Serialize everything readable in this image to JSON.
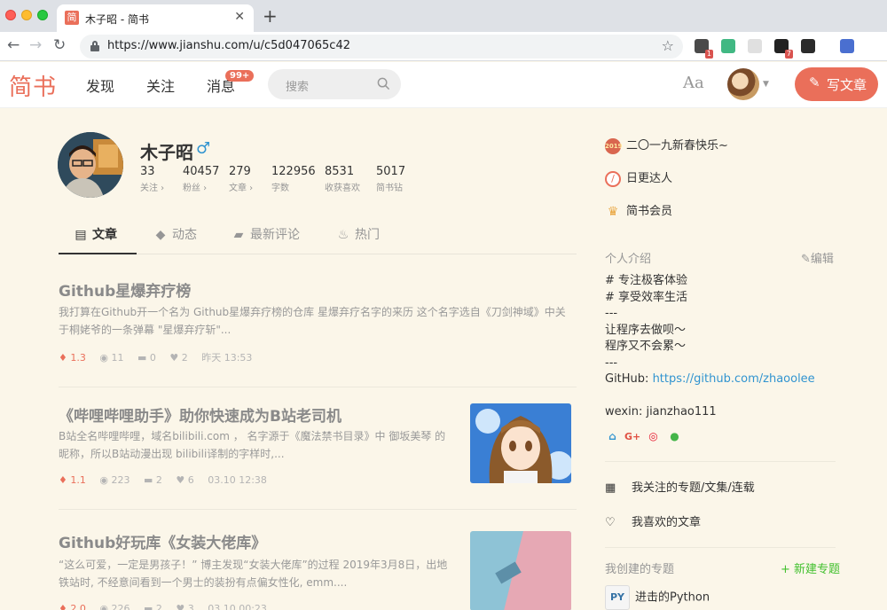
{
  "browser": {
    "tab_title": "木子昭 - 简书",
    "tab_favicon_char": "简",
    "url": "https://www.jianshu.com/u/c5d047065c42",
    "extensions": [
      {
        "name": "ext-grid-icon",
        "color": "#4a4a4a",
        "badge": "1"
      },
      {
        "name": "vue-devtools-icon",
        "color": "#41b883",
        "badge": ""
      },
      {
        "name": "blank-ext-icon",
        "color": "#e0e0e0",
        "badge": ""
      },
      {
        "name": "dark-ext-icon",
        "color": "#222222",
        "badge": "7"
      },
      {
        "name": "x-ext-icon",
        "color": "#2b2b2b",
        "badge": ""
      },
      {
        "name": "music-ext-icon",
        "color": "#4a6fd0",
        "badge": ""
      }
    ]
  },
  "site": {
    "logo": "简书",
    "nav": [
      "发现",
      "关注",
      "消息"
    ],
    "message_badge": "99+",
    "search_placeholder": "搜索",
    "font_toggle": "Aa",
    "write_label": "写文章",
    "accent": "#ea6f5a"
  },
  "profile": {
    "name": "木子昭",
    "gender_icon": "♂",
    "stats": [
      {
        "value": "33",
        "label": "关注 ›"
      },
      {
        "value": "40457",
        "label": "粉丝 ›"
      },
      {
        "value": "279",
        "label": "文章 ›"
      },
      {
        "value": "122956",
        "label": "字数"
      },
      {
        "value": "8531",
        "label": "收获喜欢"
      },
      {
        "value": "5017",
        "label": "简书钻"
      }
    ],
    "tabs": [
      "文章",
      "动态",
      "最新评论",
      "热门"
    ]
  },
  "articles": [
    {
      "title": "Github星爆弃疗榜",
      "abstract": "我打算在Github开一个名为 Github星爆弃疗榜的仓库 星爆弃疗名字的来历 这个名字选自《刀剑神域》中关于桐姥爷的一条弹幕 \"星爆弃疗斩\"...",
      "diamond": "1.3",
      "views": "11",
      "comments": "0",
      "likes": "2",
      "time": "昨天 13:53"
    },
    {
      "title": "《哔哩哔哩助手》助你快速成为B站老司机",
      "abstract": "B站全名哔哩哔哩，域名bilibili.com ， 名字源于《魔法禁书目录》中 御坂美琴 的昵称，所以B站动漫出现 bilibili译制的字样时,...",
      "diamond": "1.1",
      "views": "223",
      "comments": "2",
      "likes": "6",
      "time": "03.10 12:38"
    },
    {
      "title": "Github好玩库《女装大佬库》",
      "abstract": "“这么可爱，一定是男孩子！” 博主发现“女装大佬库”的过程 2019年3月8日，出地铁站时, 不经意间看到一个男士的装扮有点偏女性化, emm....",
      "diamond": "2.0",
      "views": "226",
      "comments": "2",
      "likes": "3",
      "time": "03.10 00:23"
    }
  ],
  "sidebar": {
    "badges": [
      "二〇一九新春快乐~",
      "日更达人",
      "简书会员"
    ],
    "badge_2019": "2019",
    "intro_title": "个人介绍",
    "edit_label": "编辑",
    "bio_lines": [
      "# 专注极客体验",
      "# 享受效率生活",
      "---",
      "让程序去做呗～",
      "程序又不会累～",
      "---"
    ],
    "github_prefix": "GitHub: ",
    "github_url": "https://github.com/zhaoolee",
    "wexin": "wexin: jianzhao111",
    "links": [
      "我关注的专题/文集/连载",
      "我喜欢的文章"
    ],
    "created_title": "我创建的专题",
    "new_topic": "+ 新建专题",
    "topic": "进击的Python",
    "topic_icon_text": "PY"
  }
}
